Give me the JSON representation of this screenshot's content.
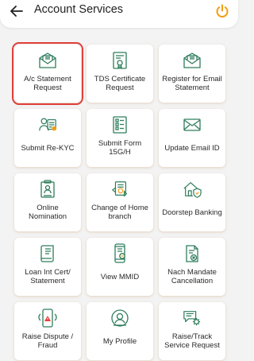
{
  "header": {
    "title": "Account Services"
  },
  "colors": {
    "accent": "#f39c12",
    "icon": "#2e7d5b",
    "selection": "#e0403a"
  },
  "tiles": [
    {
      "label": "A/c Statement\nRequest",
      "icon": "envelope-open-icon",
      "selected": true
    },
    {
      "label": "TDS Certificate\nRequest",
      "icon": "certificate-icon"
    },
    {
      "label": "Register for Email\nStatement",
      "icon": "envelope-open-icon"
    },
    {
      "label": "Submit Re-KYC",
      "icon": "person-id-card-icon"
    },
    {
      "label": "Submit Form\n15G/H",
      "icon": "form-document-icon"
    },
    {
      "label": "Update Email ID",
      "icon": "envelope-icon"
    },
    {
      "label": "Online\nNomination",
      "icon": "nomination-document-icon"
    },
    {
      "label": "Change of Home\nbranch",
      "icon": "branch-document-icon"
    },
    {
      "label": "Doorstep Banking",
      "icon": "home-shield-icon"
    },
    {
      "label": "Loan Int Cert/\nStatement",
      "icon": "certificate-scroll-icon"
    },
    {
      "label": "View MMID",
      "icon": "mobile-id-icon"
    },
    {
      "label": "Nach Mandate\nCancellation",
      "icon": "cancel-document-icon"
    },
    {
      "label": "Raise Dispute /\nFraud",
      "icon": "mobile-alert-icon"
    },
    {
      "label": "My Profile",
      "icon": "profile-icon"
    },
    {
      "label": "Raise/Track\nService Request",
      "icon": "chat-gear-icon"
    }
  ]
}
